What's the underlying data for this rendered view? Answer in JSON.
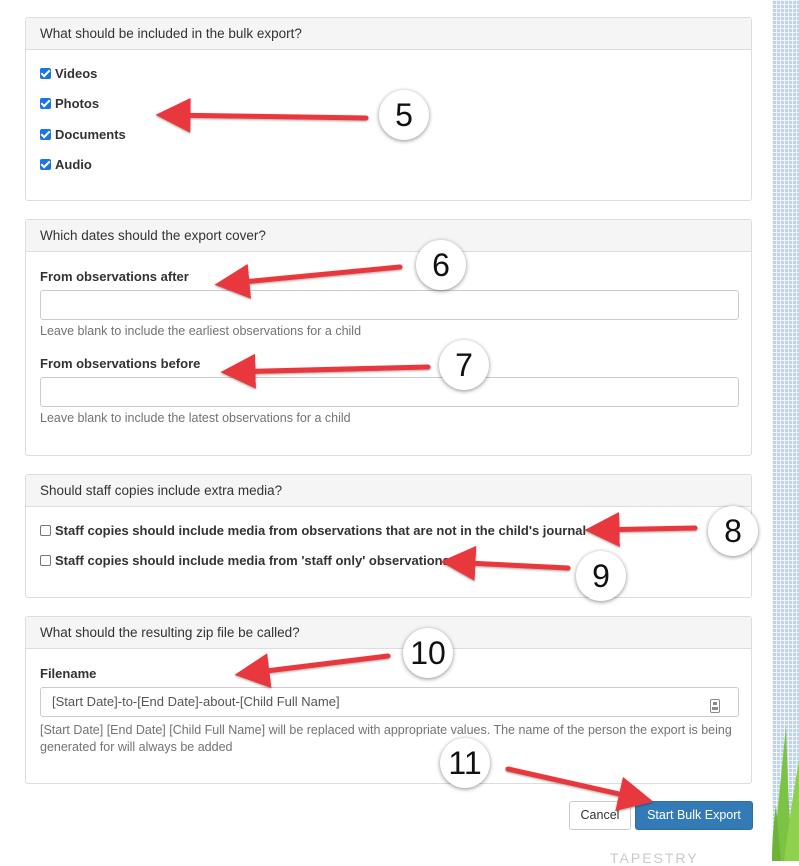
{
  "include_panel": {
    "heading": "What should be included in the bulk export?",
    "options": [
      {
        "label": "Videos",
        "checked": true
      },
      {
        "label": "Photos",
        "checked": true
      },
      {
        "label": "Documents",
        "checked": true
      },
      {
        "label": "Audio",
        "checked": true
      }
    ]
  },
  "dates_panel": {
    "heading": "Which dates should the export cover?",
    "after_label": "From observations after",
    "after_value": "",
    "after_help": "Leave blank to include the earliest observations for a child",
    "before_label": "From observations before",
    "before_value": "",
    "before_help": "Leave blank to include the latest observations for a child"
  },
  "staff_panel": {
    "heading": "Should staff copies include extra media?",
    "options": [
      {
        "label": "Staff copies should include media from observations that are not in the child's journal",
        "checked": false
      },
      {
        "label": "Staff copies should include media from 'staff only' observations",
        "checked": false
      }
    ]
  },
  "zip_panel": {
    "heading": "What should the resulting zip file be called?",
    "filename_label": "Filename",
    "filename_value": "[Start Date]-to-[End Date]-about-[Child Full Name]",
    "filename_help": "[Start Date] [End Date] [Child Full Name] will be replaced with appropriate values. The name of the person the export is being generated for will always be added"
  },
  "actions": {
    "cancel_label": "Cancel",
    "submit_label": "Start Bulk Export"
  },
  "callouts": [
    "5",
    "6",
    "7",
    "8",
    "9",
    "10",
    "11"
  ],
  "footer": {
    "brand_text": "TAPESTRY"
  },
  "colors": {
    "arrow": "#e8383d",
    "primary": "#337ab7",
    "checkbox": "#1a73e8"
  }
}
